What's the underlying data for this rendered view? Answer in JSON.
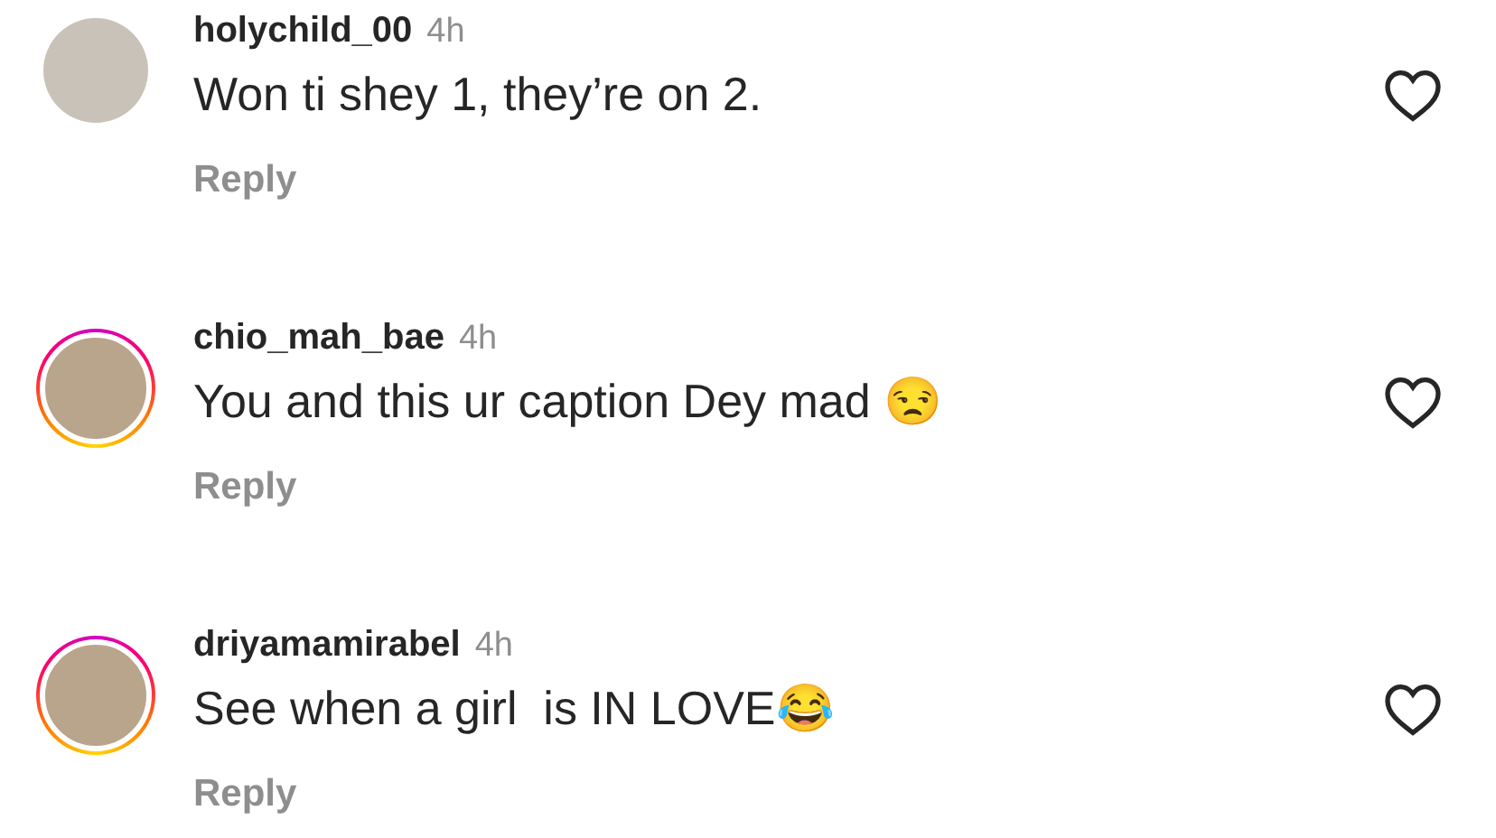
{
  "comments": [
    {
      "username": "holychild_00",
      "time": "4h",
      "text": "Won ti shey 1, they’re on 2.",
      "reply": "Reply",
      "story_ring": false,
      "liked": false
    },
    {
      "username": "chio_mah_bae",
      "time": "4h",
      "text": "You and this ur caption Dey mad 😒",
      "reply": "Reply",
      "story_ring": true,
      "liked": false
    },
    {
      "username": "driyamamirabel",
      "time": "4h",
      "text": "See when a girl  is IN LOVE😂",
      "reply": "Reply",
      "story_ring": true,
      "liked": false
    }
  ]
}
